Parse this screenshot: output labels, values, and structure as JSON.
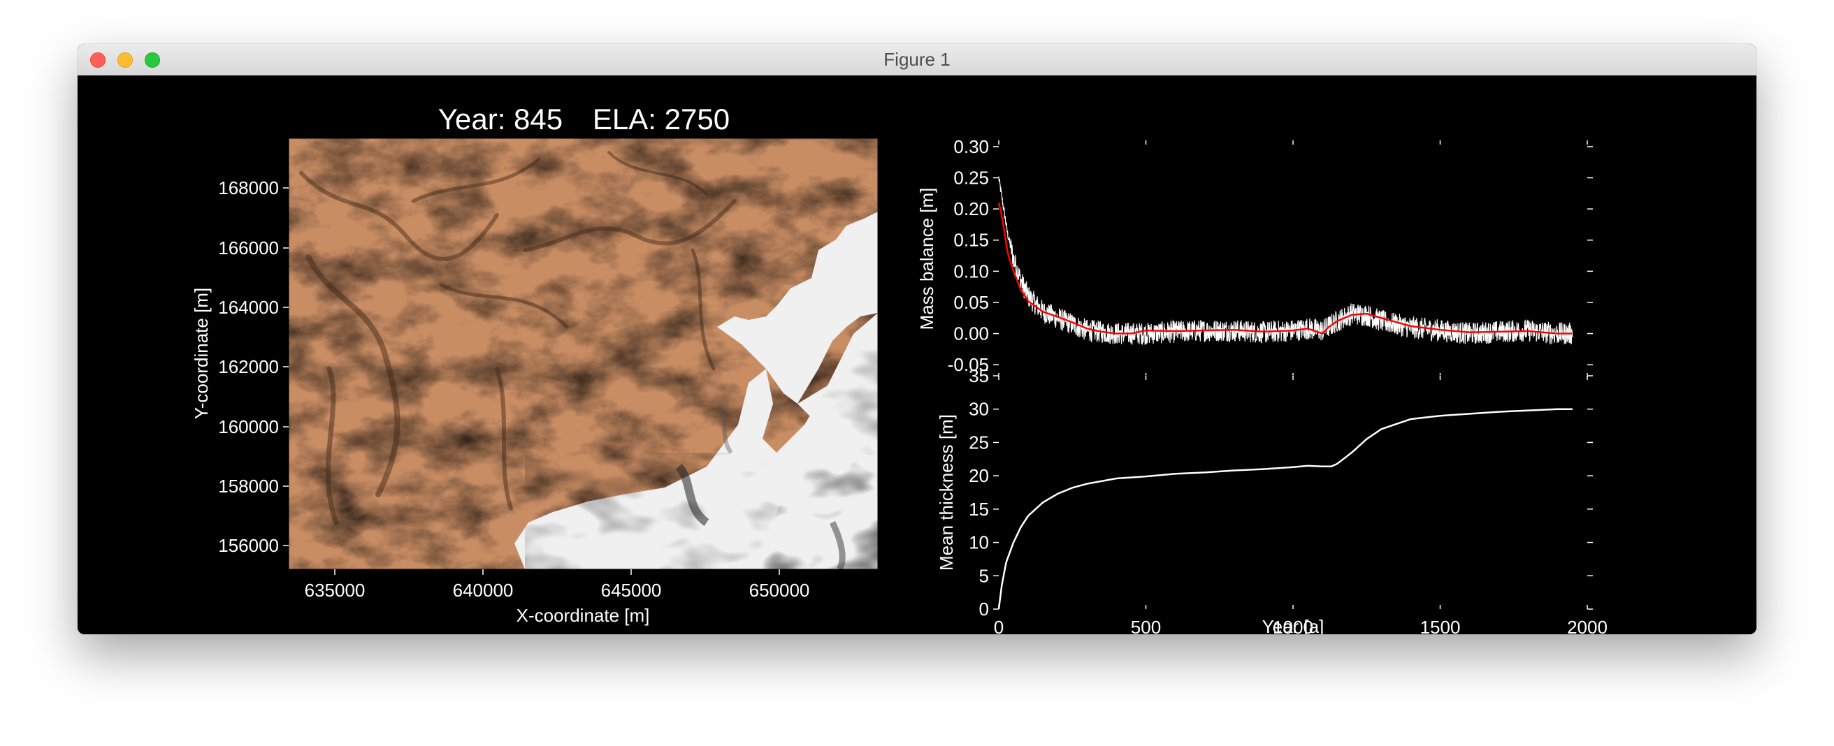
{
  "window": {
    "title": "Figure 1"
  },
  "map_panel": {
    "title_year": "Year: 845",
    "title_ela": "ELA: 2750",
    "xlabel": "X-coordinate [m]",
    "ylabel": "Y-coordinate [m]",
    "xticks": [
      "635000",
      "640000",
      "645000",
      "650000"
    ],
    "yticks": [
      "156000",
      "158000",
      "160000",
      "162000",
      "164000",
      "166000",
      "168000"
    ],
    "colors": {
      "terrain": "#c98d64",
      "ice": "#f2f2f2"
    }
  },
  "chart_data": [
    {
      "type": "line",
      "ylabel": "Mass balance [m]",
      "xlim": [
        0,
        2000
      ],
      "ylim": [
        -0.07,
        0.31
      ],
      "yticks": [
        "-0.05",
        "0.00",
        "0.05",
        "0.10",
        "0.15",
        "0.20",
        "0.25",
        "0.30"
      ],
      "grid": false,
      "series": [
        {
          "color": "#ffffff",
          "x": [
            0,
            10,
            20,
            30,
            50,
            75,
            100,
            150,
            200,
            250,
            300,
            400,
            500,
            600,
            700,
            800,
            900,
            1000,
            1050,
            1100,
            1150,
            1200,
            1250,
            1300,
            1400,
            1500,
            1600,
            1700,
            1800,
            1900,
            1950
          ],
          "values": [
            0.25,
            0.22,
            0.19,
            0.16,
            0.12,
            0.085,
            0.06,
            0.035,
            0.025,
            0.015,
            0.005,
            0.0,
            0.0,
            0.003,
            0.005,
            0.005,
            0.002,
            0.005,
            0.008,
            0.005,
            0.02,
            0.032,
            0.03,
            0.02,
            0.01,
            0.005,
            0.0,
            0.003,
            0.005,
            0.0,
            0.0
          ],
          "noise_amplitude": 0.018
        },
        {
          "color": "#ff0000",
          "x": [
            0,
            10,
            20,
            30,
            50,
            75,
            100,
            150,
            200,
            250,
            300,
            350,
            400,
            450,
            500,
            600,
            700,
            800,
            900,
            1000,
            1050,
            1100,
            1120,
            1150,
            1200,
            1250,
            1300,
            1400,
            1500,
            1600,
            1700,
            1800,
            1900,
            1950
          ],
          "values": [
            0.21,
            0.19,
            0.16,
            0.13,
            0.1,
            0.07,
            0.052,
            0.035,
            0.027,
            0.018,
            0.008,
            0.003,
            0.0,
            0.0,
            0.005,
            0.004,
            0.005,
            0.006,
            0.003,
            0.005,
            0.008,
            0.0,
            0.01,
            0.02,
            0.03,
            0.032,
            0.025,
            0.012,
            0.006,
            0.002,
            0.003,
            0.004,
            0.0,
            0.0
          ]
        }
      ]
    },
    {
      "type": "line",
      "xlabel": "Year [a]",
      "ylabel": "Mean thickness [m]",
      "xlim": [
        0,
        2000
      ],
      "ylim": [
        0,
        35
      ],
      "xticks": [
        "0",
        "500",
        "1000",
        "1500",
        "2000"
      ],
      "yticks": [
        "0",
        "5",
        "10",
        "15",
        "20",
        "25",
        "30",
        "35"
      ],
      "grid": false,
      "series": [
        {
          "color": "#ffffff",
          "x": [
            0,
            10,
            25,
            50,
            75,
            100,
            150,
            200,
            250,
            300,
            350,
            400,
            500,
            600,
            700,
            800,
            900,
            1000,
            1050,
            1100,
            1130,
            1150,
            1200,
            1250,
            1300,
            1400,
            1500,
            1600,
            1700,
            1800,
            1900,
            1950
          ],
          "values": [
            0,
            3.5,
            7,
            10,
            12.3,
            14,
            16,
            17.3,
            18.2,
            18.8,
            19.2,
            19.6,
            19.9,
            20.3,
            20.5,
            20.8,
            21.0,
            21.3,
            21.5,
            21.4,
            21.4,
            21.8,
            23.5,
            25.5,
            27.0,
            28.5,
            29.0,
            29.3,
            29.6,
            29.8,
            30.0,
            30.0
          ]
        }
      ]
    }
  ]
}
